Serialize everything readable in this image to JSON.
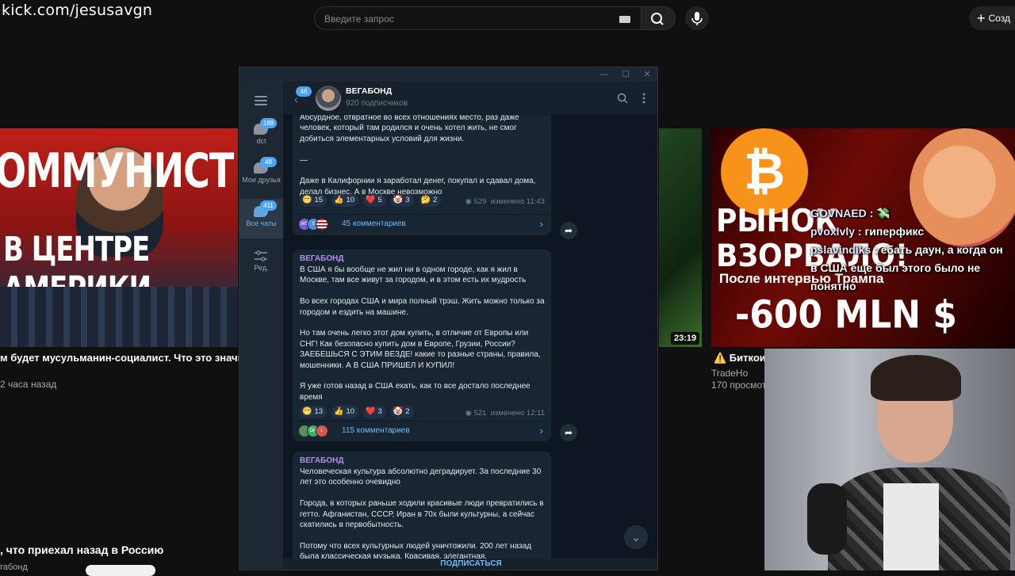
{
  "overlay": {
    "stream_url": "kick.com/jesusavgn"
  },
  "youtube": {
    "search_placeholder": "Введите запрос",
    "create_label": "Созд",
    "videos": {
      "left": {
        "thumb_top": "ОММУНИСТ",
        "thumb_bottom": "В ЦЕНТРЕ АМЕРИКИ",
        "title": "м будет мусульманин-социалист. Что это значит?",
        "meta": "2 часа назад"
      },
      "middle": {
        "duration": "23:19"
      },
      "right": {
        "thumb_line1": "РЫНОК",
        "thumb_line2": "ВЗОРВАЛО!",
        "thumb_after": "После интервью Трампа",
        "thumb_amount": "-600 MLN $",
        "title": "⚠️ Биткои",
        "channel": "TradeHo",
        "views": "170 просмот"
      },
      "bottom": {
        "title": ", что приехал назад в Россию",
        "channel": "габонд"
      }
    }
  },
  "stream_chat": [
    {
      "user": "GOVNAED",
      "text": ": 💸"
    },
    {
      "user": "pvoxlvly",
      "text": ": гиперфикс"
    },
    {
      "user": "pslavindiks",
      "text": ": ебать даун, а когда он в США еще был этого было не понятно"
    }
  ],
  "telegram": {
    "window_buttons": [
      "—",
      "☐",
      "✕"
    ],
    "folders": [
      {
        "label": "dct",
        "badge": "188",
        "active": false
      },
      {
        "label": "Мои друзья",
        "badge": "48",
        "active": false
      },
      {
        "label": "Все чаты",
        "badge": "411",
        "active": true
      },
      {
        "label": "Ред.",
        "badge": "",
        "active": false
      }
    ],
    "header": {
      "back_badge": "46",
      "channel_name": "ВЕГАБОНД",
      "subscribers": "920 подписчиков"
    },
    "posts": [
      {
        "author": "",
        "text": "Абсурдное, отвратное во всех отношениях место, раз даже человек, который там родился и очень хотел жить, не смог добиться элементарных условий для жизни.\n\n—\n\nДаже в Калифорнии я заработал денег, покупал и сдавал дома, делал бизнес. А в Москве невозможно",
        "reactions": [
          {
            "emoji": "😁",
            "count": "15"
          },
          {
            "emoji": "👍",
            "count": "10"
          },
          {
            "emoji": "❤️",
            "count": "5"
          },
          {
            "emoji": "🤡",
            "count": "3"
          },
          {
            "emoji": "🤔",
            "count": "2"
          }
        ],
        "views": "529",
        "edited": "изменено 11:43",
        "comments": "45 комментариев",
        "comment_avatars": [
          "WS",
          "S",
          ""
        ]
      },
      {
        "author": "ВЕГАБОНД",
        "text": "В США я бы вообще не жил ни в одном городе, как я жил в Москве, там все живут за городом, и в этом есть их мудрость\n\nВо всех городах США и мира полный трэш. Жить можно только за городом и ездить на машине.\n\nНо там очень легко этот дом купить, в отличие от Европы или СНГ! Как безопасно купить дом в Европе, Грузии, России? ЗАЕБЕШЬСЯ С ЭТИМ ВЕЗДЕ! какие то разные страны, правила, мошенники. А В США ПРИШЕЛ И КУПИЛ!\n\nЯ уже готов назад в США ехать. как то все достало последнее время",
        "reactions": [
          {
            "emoji": "😁",
            "count": "13"
          },
          {
            "emoji": "👍",
            "count": "10"
          },
          {
            "emoji": "❤️",
            "count": "3"
          },
          {
            "emoji": "🤡",
            "count": "2"
          }
        ],
        "views": "521",
        "edited": "изменено 12:11",
        "comments": "115 комментариев",
        "comment_avatars": [
          "",
          "DH",
          "L"
        ]
      },
      {
        "author": "ВЕГАБОНД",
        "text": "Человеческая культура абсолютно деградирует. За последние 30 лет это особенно очевидно\n\nГорода, в которых раньше ходили красивые люди превратились в гетто. Афганистан, СССР, Иран в 70х были культурны, а сейчас скатились в первобытность.\n\nПотому что всех культурных людей уничтожили. 200 лет назад была классическая музыка. Красивая, элегантная."
      }
    ],
    "subscribe_label": "ПОДПИСАТЬСЯ"
  },
  "colors": {
    "tg_bg": "#0e1621",
    "tg_bubble": "#182533",
    "tg_accent": "#71baf6",
    "author": "#b28ee8"
  }
}
